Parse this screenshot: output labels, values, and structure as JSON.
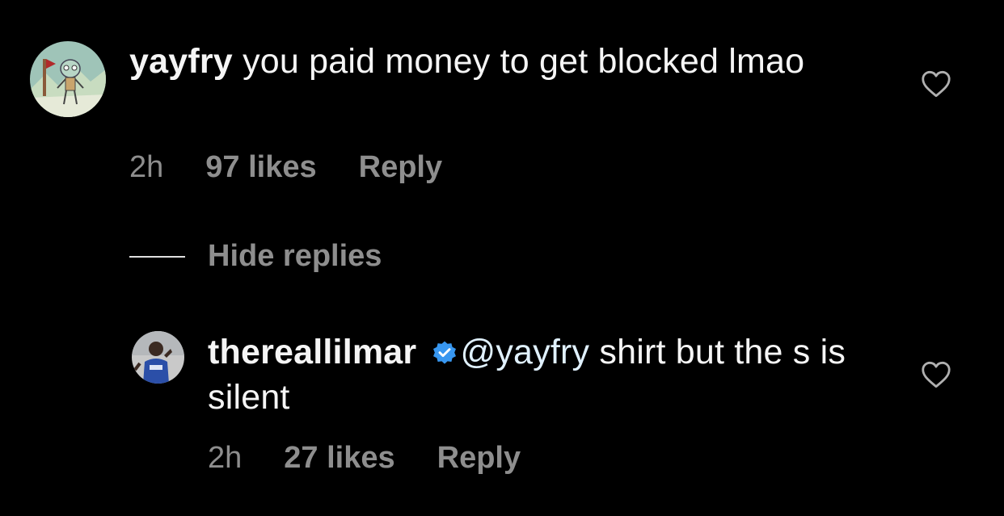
{
  "comments": [
    {
      "username": "yayfry",
      "verified": false,
      "mention": "",
      "text": " you paid money to get blocked lmao",
      "time": "2h",
      "likes": "97 likes",
      "reply_label": "Reply",
      "avatar_icon": "cartoon-character-avatar",
      "like_icon": "heart-outline-icon"
    },
    {
      "username": "thereallilmar",
      "verified": true,
      "mention": "@yayfry",
      "text": " shirt but the s is silent",
      "time": "2h",
      "likes": "27 likes",
      "reply_label": "Reply",
      "avatar_icon": "person-photo-avatar",
      "like_icon": "heart-outline-icon"
    }
  ],
  "replies_toggle": {
    "label": "Hide replies"
  },
  "colors": {
    "background": "#000000",
    "text": "#f5f5f5",
    "secondary_text": "#8e8e8e",
    "mention": "#e0f1ff",
    "verified_badge": "#3897f0"
  }
}
